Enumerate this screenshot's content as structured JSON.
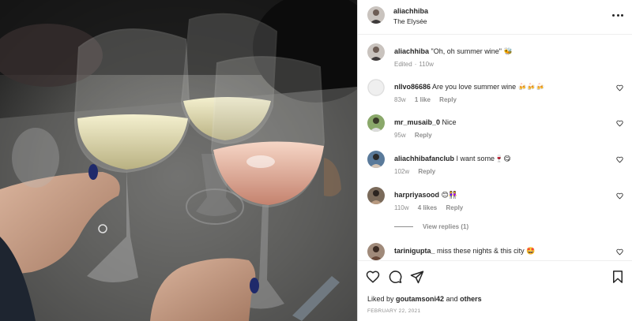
{
  "post": {
    "username": "aliachhiba",
    "location": "The Elysée",
    "photo_alt": "Four wine glasses clinking together over a dark table"
  },
  "caption": {
    "username": "aliachhiba",
    "text": "\"Oh, oh summer wine\"",
    "emoji": "🐝",
    "meta_edited": "Edited",
    "meta_time": "110w"
  },
  "comments": [
    {
      "username": "nllvo86686",
      "text": "Are you love summer wine",
      "emoji": "🍻🍻🍻",
      "time": "83w",
      "likes": "1 like",
      "reply": "Reply"
    },
    {
      "username": "mr_musaib_0",
      "text": "Nice",
      "emoji": "",
      "time": "95w",
      "likes": "",
      "reply": "Reply"
    },
    {
      "username": "aliachhibafanclub",
      "text": "I want some",
      "emoji": "🍷😋",
      "time": "102w",
      "likes": "",
      "reply": "Reply"
    },
    {
      "username": "harpriyasood",
      "text": "",
      "emoji": "😊👭",
      "time": "110w",
      "likes": "4 likes",
      "reply": "Reply"
    },
    {
      "username": "tarinigupta_",
      "text": "miss these nights & this city",
      "emoji": "🤩",
      "time": "",
      "likes": "",
      "reply": ""
    }
  ],
  "view_replies": "View replies (1)",
  "likes": {
    "prefix": "Liked by",
    "user": "goutamsoni42",
    "conj": "and",
    "others": "others"
  },
  "date": "FEBRUARY 22, 2021",
  "icons": [
    "more-icon",
    "heart-icon",
    "comment-icon",
    "share-icon",
    "bookmark-icon"
  ],
  "colors": {
    "text": "#262626",
    "muted": "#8e8e8e",
    "border": "#dbdbdb"
  }
}
